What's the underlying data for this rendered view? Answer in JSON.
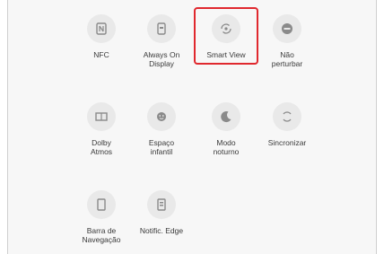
{
  "tiles": [
    {
      "label": "NFC",
      "icon": "nfc-icon"
    },
    {
      "label": "Always On\nDisplay",
      "icon": "always-on-display-icon"
    },
    {
      "label": "Smart View",
      "icon": "smart-view-icon"
    },
    {
      "label": "Não\nperturbar",
      "icon": "do-not-disturb-icon"
    },
    {
      "label": "Dolby\nAtmos",
      "icon": "dolby-atmos-icon"
    },
    {
      "label": "Espaço\ninfantil",
      "icon": "kids-space-icon"
    },
    {
      "label": "Modo\nnoturno",
      "icon": "night-mode-icon"
    },
    {
      "label": "Sincronizar",
      "icon": "sync-icon"
    },
    {
      "label": "Barra de\nNavegação",
      "icon": "navigation-bar-icon"
    },
    {
      "label": "Notific. Edge",
      "icon": "edge-notification-icon"
    }
  ],
  "highlight_color": "#e0282e"
}
